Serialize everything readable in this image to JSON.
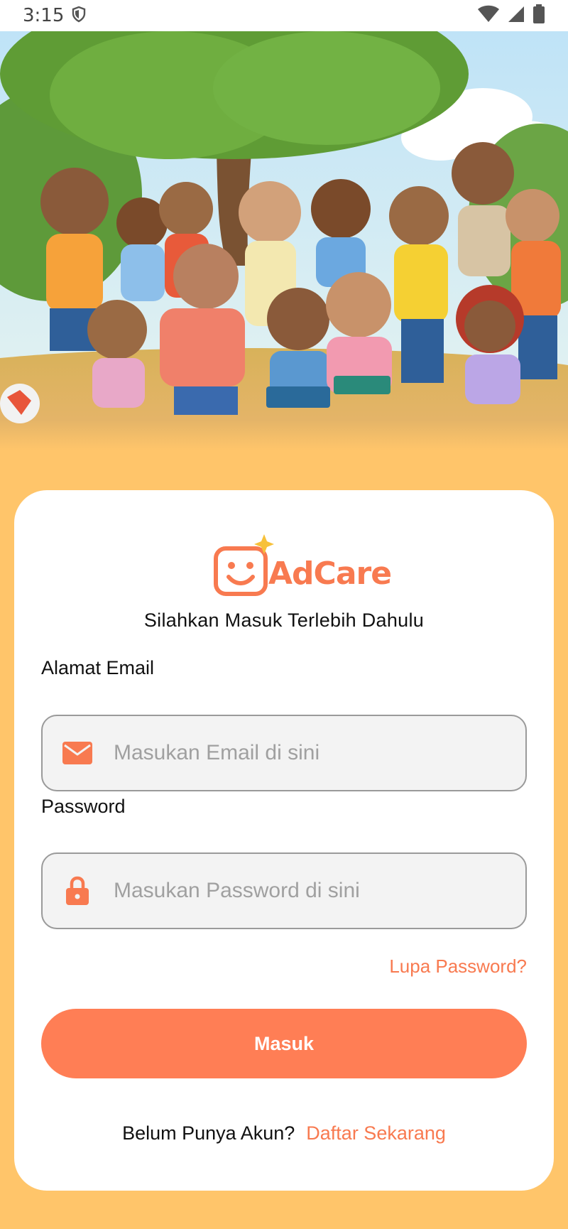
{
  "status_bar": {
    "time": "3:15",
    "icons": [
      "shield-icon",
      "wifi-icon",
      "signal-icon",
      "battery-icon"
    ]
  },
  "hero": {
    "image": "illustration-children-under-tree"
  },
  "brand": {
    "name": "AdCare",
    "accent_color": "#F87A50",
    "background_color": "#FFC56A"
  },
  "login": {
    "subtitle": "Silahkan Masuk Terlebih Dahulu",
    "email_label": "Alamat Email",
    "email_placeholder": "Masukan Email di sini",
    "email_icon": "mail-icon",
    "password_label": "Password",
    "password_placeholder": "Masukan Password di sini",
    "password_icon": "lock-icon",
    "forgot_label": "Lupa Password?",
    "submit_label": "Masuk",
    "register_question": "Belum Punya Akun?",
    "register_link": "Daftar Sekarang"
  }
}
